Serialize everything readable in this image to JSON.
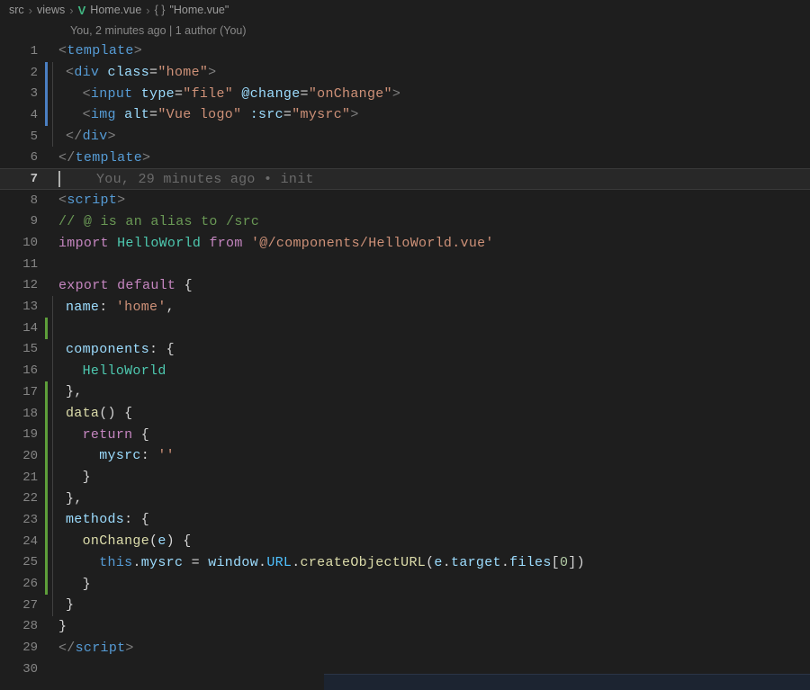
{
  "breadcrumbs": {
    "seg1": "src",
    "seg2": "views",
    "seg3": "Home.vue",
    "seg4": "\"Home.vue\""
  },
  "annotation_top": "You, 2 minutes ago | 1 author (You)",
  "lens_line7": "You, 29 minutes ago • init",
  "line_numbers": [
    "1",
    "2",
    "3",
    "4",
    "5",
    "6",
    "7",
    "8",
    "9",
    "10",
    "11",
    "12",
    "13",
    "14",
    "15",
    "16",
    "17",
    "18",
    "19",
    "20",
    "21",
    "22",
    "23",
    "24",
    "25",
    "26",
    "27",
    "28",
    "29",
    "30"
  ],
  "code": {
    "l1": {
      "p1": "<",
      "tag": "template",
      "p2": ">"
    },
    "l2": {
      "p1": "<",
      "tag": "div",
      "sp": " ",
      "attr": "class",
      "eq": "=",
      "str": "\"home\"",
      "p2": ">"
    },
    "l3": {
      "p1": "<",
      "tag": "input",
      "sp": " ",
      "attr1": "type",
      "eq1": "=",
      "str1": "\"file\"",
      "sp2": " ",
      "attr2": "@change",
      "eq2": "=",
      "str2": "\"onChange\"",
      "p2": ">"
    },
    "l4": {
      "p1": "<",
      "tag": "img",
      "sp": " ",
      "attr1": "alt",
      "eq1": "=",
      "str1": "\"Vue logo\"",
      "sp2": " ",
      "attr2": ":src",
      "eq2": "=",
      "str2": "\"mysrc\"",
      "p2": ">"
    },
    "l5": {
      "p1": "</",
      "tag": "div",
      "p2": ">"
    },
    "l6": {
      "p1": "</",
      "tag": "template",
      "p2": ">"
    },
    "l8": {
      "p1": "<",
      "tag": "script",
      "p2": ">"
    },
    "l9": {
      "cmt": "// @ is an alias to /src"
    },
    "l10": {
      "kw1": "import",
      "sp1": " ",
      "type": "HelloWorld",
      "sp2": " ",
      "kw2": "from",
      "sp3": " ",
      "str": "'@/components/HelloWorld.vue'"
    },
    "l12": {
      "kw1": "export",
      "sp": " ",
      "kw2": "default",
      "sp2": " ",
      "br": "{"
    },
    "l13": {
      "id": "name",
      "c": ":",
      "sp": " ",
      "str": "'home'",
      "cm": ","
    },
    "l15": {
      "id": "components",
      "c": ":",
      "sp": " ",
      "br": "{"
    },
    "l16": {
      "type": "HelloWorld"
    },
    "l17": {
      "br": "}",
      "cm": ","
    },
    "l18": {
      "meth": "data",
      "pr": "()",
      "sp": " ",
      "br": "{"
    },
    "l19": {
      "kw": "return",
      "sp": " ",
      "br": "{"
    },
    "l20": {
      "id": "mysrc",
      "c": ":",
      "sp": " ",
      "str": "''"
    },
    "l21": {
      "br": "}"
    },
    "l22": {
      "br": "}",
      "cm": ","
    },
    "l23": {
      "id": "methods",
      "c": ":",
      "sp": " ",
      "br": "{"
    },
    "l24": {
      "meth": "onChange",
      "p1": "(",
      "arg": "e",
      "p2": ")",
      "sp": " ",
      "br": "{"
    },
    "l25": {
      "th": "this",
      "d1": ".",
      "p1": "mysrc",
      "sp1": " ",
      "eq": "=",
      "sp2": " ",
      "v1": "window",
      "d2": ".",
      "v2": "URL",
      "d3": ".",
      "meth": "createObjectURL",
      "p2": "(",
      "arg": "e",
      "d4": ".",
      "p3": "target",
      "d5": ".",
      "p4": "files",
      "br1": "[",
      "num": "0",
      "br2": "]",
      ")": ")"
    },
    "l26": {
      "br": "}"
    },
    "l27": {
      "br": "}"
    },
    "l28": {
      "br": "}"
    },
    "l29": {
      "p1": "</",
      "tag": "script",
      "p2": ">"
    }
  }
}
